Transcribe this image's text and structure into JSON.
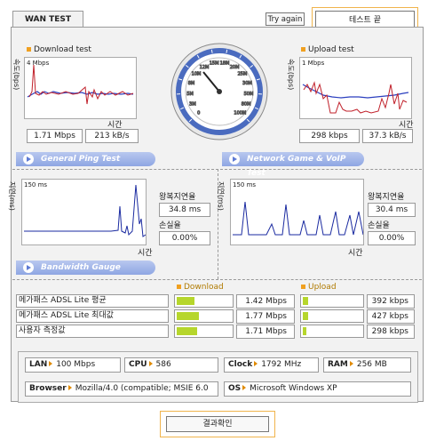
{
  "app": {
    "tab_title": "WAN TEST",
    "try_again": "Try again",
    "end_test": "테스트 끝",
    "confirm": "결과확인"
  },
  "download": {
    "title": "Download test",
    "axis_y": "속도(bps)",
    "axis_x": "시간",
    "scale": "4 Mbps",
    "mbps": "1.71 Mbps",
    "kbs": "213 kB/s"
  },
  "upload": {
    "title": "Upload test",
    "axis_y": "속도(bps)",
    "axis_x": "시간",
    "scale": "1 Mbps",
    "kbps": "298 kbps",
    "kbs": "37.3 kB/s"
  },
  "gauge": {
    "ticks": [
      "0",
      "3M",
      "5M",
      "8M",
      "10M",
      "12M",
      "15M",
      "18M",
      "20M",
      "25M",
      "30M",
      "50M",
      "80M",
      "100M"
    ],
    "needle_value": "1.71M"
  },
  "sections": {
    "ping": "General Ping Test",
    "game": "Network Game & VoIP Test",
    "bandwidth": "Bandwidth Gauge"
  },
  "ping": {
    "axis_y": "지연(ms)",
    "axis_x": "시간",
    "scale": "150 ms",
    "latency_label": "왕복지연율",
    "latency": "34.8 ms",
    "loss_label": "손실율",
    "loss": "0.00%"
  },
  "game": {
    "axis_y": "지연(ms)",
    "axis_x": "시간",
    "scale": "150 ms",
    "latency_label": "왕복지연율",
    "latency": "30.4 ms",
    "loss_label": "손실율",
    "loss": "0.00%"
  },
  "bandwidth": {
    "download_header": "Download",
    "upload_header": "Upload",
    "rows": [
      {
        "label": "메가패스 ADSL Lite 평균",
        "down": "1.42 Mbps",
        "down_fill": 0.3,
        "up": "392 kbps",
        "up_fill": 0.08
      },
      {
        "label": "메가패스 ADSL Lite 최대값",
        "down": "1.77 Mbps",
        "down_fill": 0.38,
        "up": "427 kbps",
        "up_fill": 0.09
      },
      {
        "label": "사용자 측정값",
        "down": "1.71 Mbps",
        "down_fill": 0.36,
        "up": "298 kbps",
        "up_fill": 0.06
      }
    ]
  },
  "info": {
    "lan_label": "LAN",
    "lan": "100 Mbps",
    "cpu_label": "CPU",
    "cpu": "586",
    "clock_label": "Clock",
    "clock": "1792 MHz",
    "ram_label": "RAM",
    "ram": "256 MB",
    "browser_label": "Browser",
    "browser": "Mozilla/4.0 (compatible; MSIE 6.0",
    "os_label": "OS",
    "os": "Microsoft Windows XP"
  },
  "colors": {
    "bar": "#b6d62c",
    "section": "#8ea6e3",
    "accent": "#f0a020"
  }
}
